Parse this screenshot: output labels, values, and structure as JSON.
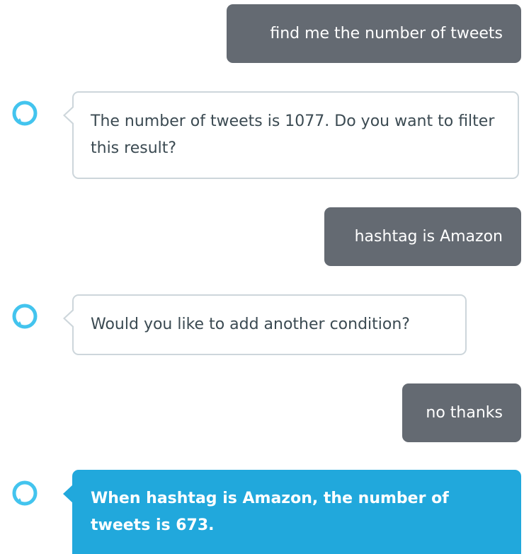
{
  "colors": {
    "user_bubble": "#646a72",
    "accent": "#21a8dc",
    "avatar_ring": "#43c4ee",
    "bubble_border": "#cdd6db",
    "alexa_text": "#3b4a52"
  },
  "messages": [
    {
      "role": "user",
      "text": "find me the number of tweets"
    },
    {
      "role": "alexa",
      "icon": "alexa-ring-icon",
      "text": "The number of tweets is 1077. Do you want to filter this result?"
    },
    {
      "role": "user",
      "text": "hashtag is Amazon"
    },
    {
      "role": "alexa",
      "icon": "alexa-ring-icon",
      "text": "Would you like to add another condition?"
    },
    {
      "role": "user",
      "text": "no thanks"
    },
    {
      "role": "alexa",
      "icon": "alexa-ring-icon",
      "highlighted": true,
      "text": "When hashtag is Amazon, the number of tweets is 673."
    }
  ]
}
